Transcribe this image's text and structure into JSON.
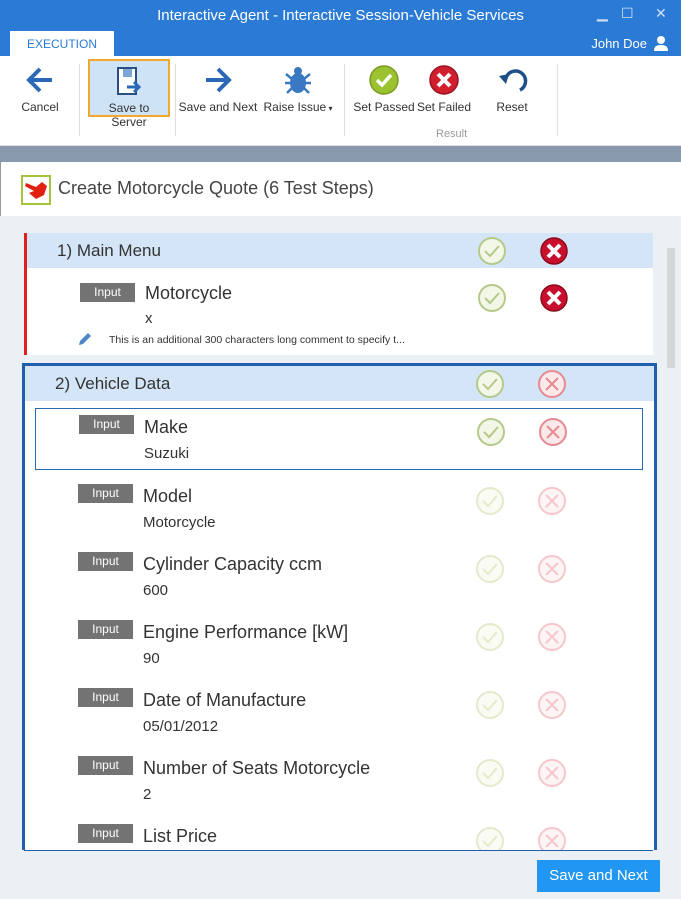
{
  "window": {
    "title": "Interactive Agent - Interactive Session-Vehicle Services",
    "tab": "EXECUTION",
    "user": "John Doe"
  },
  "ribbon": {
    "cancel": "Cancel",
    "save_to_server": "Save to Server",
    "save_and_next": "Save and Next",
    "raise_issue": "Raise Issue",
    "set_passed": "Set Passed",
    "set_failed": "Set Failed",
    "reset": "Reset",
    "group_result": "Result"
  },
  "test": {
    "title": "Create Motorcycle Quote (6 Test Steps)"
  },
  "groups": [
    {
      "label": "1)  Main Menu",
      "status": "failed",
      "steps": [
        {
          "type": "Input",
          "name": "Motorcycle",
          "value": "x",
          "comment": "This is an additional 300 characters long comment to specify t...",
          "status": "failed"
        }
      ]
    },
    {
      "label": "2)  Vehicle Data",
      "status": "pending",
      "steps": [
        {
          "type": "Input",
          "name": "Make",
          "value": "Suzuki",
          "status": "pending"
        },
        {
          "type": "Input",
          "name": "Model",
          "value": "Motorcycle"
        },
        {
          "type": "Input",
          "name": "Cylinder Capacity ccm",
          "value": "600"
        },
        {
          "type": "Input",
          "name": "Engine Performance [kW]",
          "value": "90"
        },
        {
          "type": "Input",
          "name": "Date of Manufacture",
          "value": "05/01/2012"
        },
        {
          "type": "Input",
          "name": "Number of Seats Motorcycle",
          "value": "2"
        },
        {
          "type": "Input",
          "name": "List Price",
          "value": ""
        }
      ]
    }
  ],
  "footer": {
    "save_and_next": "Save and Next"
  },
  "colors": {
    "accent": "#2b7bd6",
    "failed": "#c8102e",
    "passed": "#8db33a",
    "group_failed_border": "#e02020",
    "group_active_border": "#1f5fae"
  }
}
